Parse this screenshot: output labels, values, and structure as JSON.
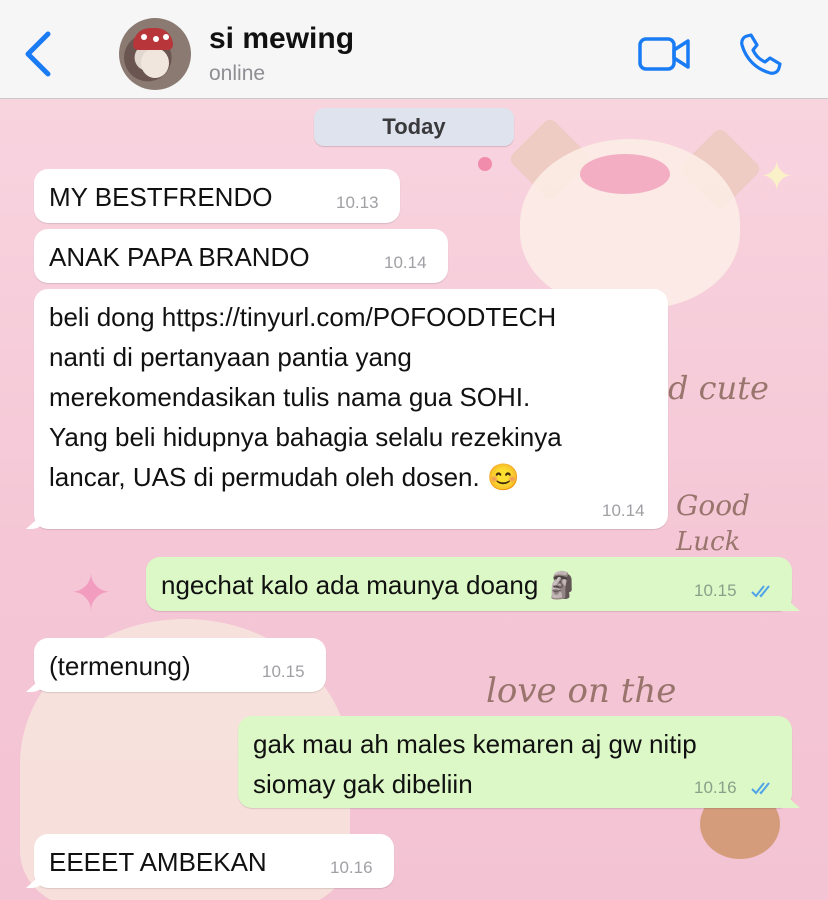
{
  "header": {
    "contact_name": "si mewing",
    "status": "online",
    "icons": [
      "chevron-left-icon",
      "video-camera-icon",
      "phone-icon"
    ],
    "accent_color": "#1a7cf5"
  },
  "date_separator": "Today",
  "messages": [
    {
      "direction": "in",
      "text": "MY BESTFRENDO",
      "time": "10.13"
    },
    {
      "direction": "in",
      "text": "ANAK PAPA BRANDO",
      "time": "10.14"
    },
    {
      "direction": "in",
      "text": "beli dong https://tinyurl.com/POFOODTECH\nnanti di pertanyaan pantia yang\nmerekomendasikan tulis nama gua SOHI.\nYang beli hidupnya bahagia selalu rezekinya\nlancar, UAS di permudah oleh dosen. 😊",
      "time": "10.14"
    },
    {
      "direction": "out",
      "text": "ngechat kalo ada maunya doang 🗿",
      "time": "10.15",
      "read": true
    },
    {
      "direction": "in",
      "text": "(termenung)",
      "time": "10.15"
    },
    {
      "direction": "out",
      "text": "gak mau ah males kemaren aj gw nitip\nsiomay gak dibeliin",
      "time": "10.16",
      "read": true
    },
    {
      "direction": "in",
      "text": "EEEET AMBEKAN",
      "time": "10.16"
    }
  ],
  "wallpaper_text": [
    "d cute",
    "Good",
    "Luck",
    "love on the"
  ],
  "colors": {
    "incoming_bubble": "#ffffff",
    "outgoing_bubble": "#dcf8c6",
    "read_ticks": "#4fa3e8",
    "wallpaper": "#f7cfdc"
  }
}
